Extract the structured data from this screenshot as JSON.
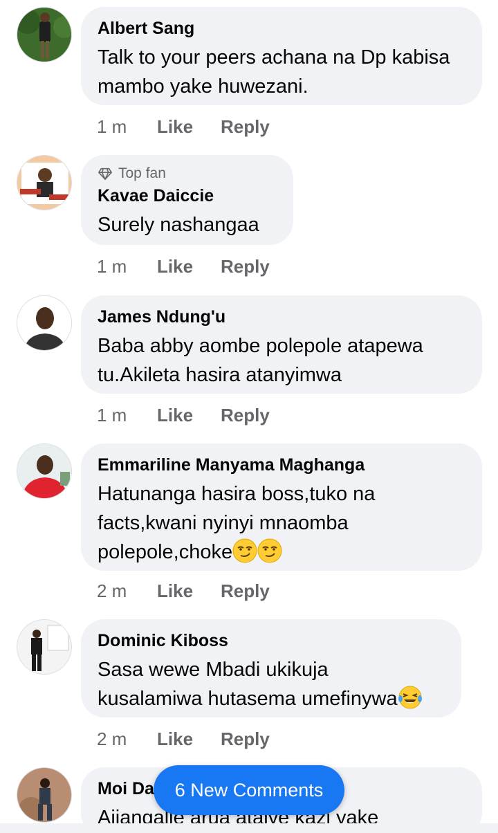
{
  "comments": [
    {
      "author": "Albert Sang",
      "text": "Talk to your peers achana na Dp kabisa mambo yake huwezani.",
      "time": "1 m",
      "like": "Like",
      "reply": "Reply"
    },
    {
      "badge": "Top fan",
      "author": "Kavae Daiccie",
      "text": "Surely nashangaa",
      "time": "1 m",
      "like": "Like",
      "reply": "Reply"
    },
    {
      "author": "James Ndung'u",
      "text": "Baba abby aombe polepole atapewa tu.Akileta hasira atanyimwa",
      "time": "1 m",
      "like": "Like",
      "reply": "Reply"
    },
    {
      "author": "Emmariline Manyama Maghanga",
      "text_line1": "Hatunanga hasira boss,tuko na",
      "text_line2": "facts,kwani nyinyi mnaomba",
      "text_line3": "polepole,choke",
      "time": "2 m",
      "like": "Like",
      "reply": "Reply"
    },
    {
      "author": "Dominic Kiboss",
      "text_line1": "Sasa wewe Mbadi ukikuja",
      "text_line2": "kusalamiwa hutasema umefinywa",
      "time": "2 m",
      "like": "Like",
      "reply": "Reply"
    },
    {
      "author": "Moi Da",
      "text": "Aijangalie arua ataiye kazi yake"
    }
  ],
  "new_comments_pill": "6 New Comments",
  "icons": {
    "top_fan": "diamond-icon",
    "smirk": "smirking-face-emoji",
    "laugh": "tears-of-joy-emoji"
  },
  "colors": {
    "bubble": "#f0f2f5",
    "meta": "#65676b",
    "accent": "#1877f2"
  }
}
